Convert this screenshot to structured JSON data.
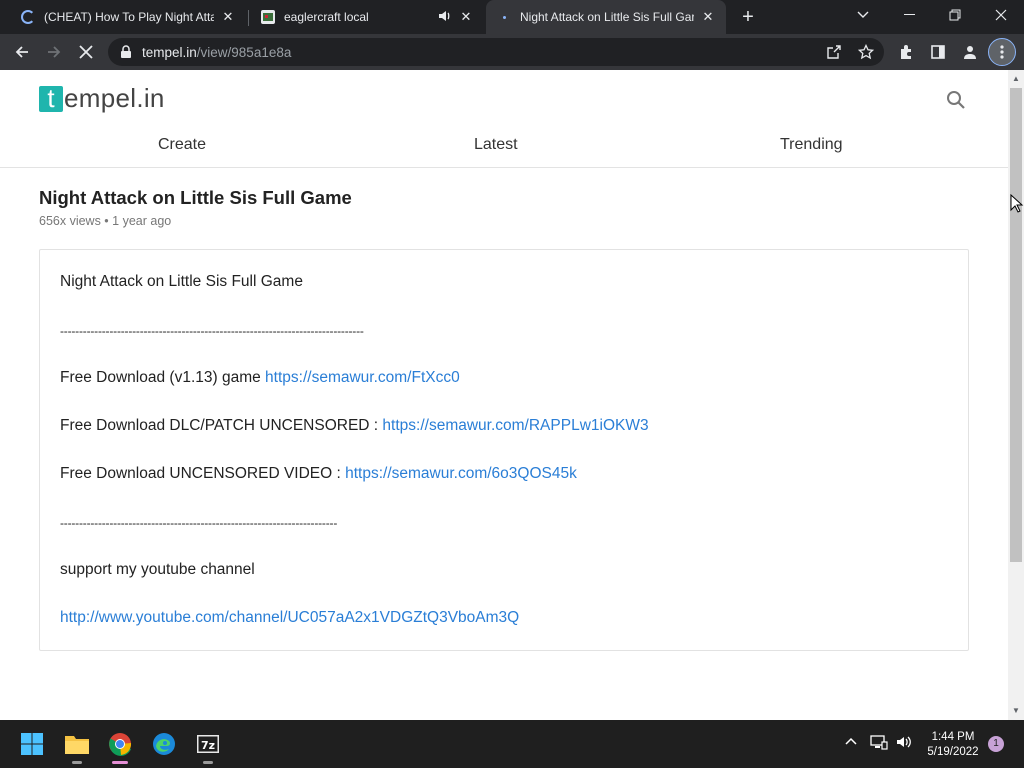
{
  "browser": {
    "tabs": [
      {
        "title": "(CHEAT) How To Play Night Attac",
        "state": "loading"
      },
      {
        "title": "eaglercraft local",
        "state": "audio"
      },
      {
        "title": "Night Attack on Little Sis Full Gar",
        "state": "active"
      }
    ],
    "url": {
      "host": "tempel.in",
      "path": "/view/985a1e8a"
    }
  },
  "site": {
    "logo_t": "t",
    "logo_rest": "empel.in",
    "nav": [
      "Create",
      "Latest",
      "Trending"
    ]
  },
  "post": {
    "title": "Night Attack on Little Sis Full Game",
    "meta": "656x views • 1 year ago",
    "heading": "Night Attack on Little Sis Full Game",
    "divider1": "--------------------------------------------------------------------------------",
    "download1_label": "Free Download (v1.13) game ",
    "download1_link": "https://semawur.com/FtXcc0",
    "download2_label": "Free Download DLC/PATCH UNCENSORED : ",
    "download2_link": "https://semawur.com/RAPPLw1iOKW3",
    "download3_label": "Free Download UNCENSORED VIDEO : ",
    "download3_link": "https://semawur.com/6o3QOS45k",
    "divider2": "-------------------------------------------------------------------------",
    "support_text": "support my youtube channel",
    "youtube_link": "http://www.youtube.com/channel/UC057aA2x1VDGZtQ3VboAm3Q"
  },
  "taskbar": {
    "time": "1:44 PM",
    "date": "5/19/2022",
    "notification_count": "1"
  },
  "colors": {
    "logo_accent": "#1fb5ad",
    "link": "#2a7ed6",
    "browser_dark": "#202124"
  }
}
